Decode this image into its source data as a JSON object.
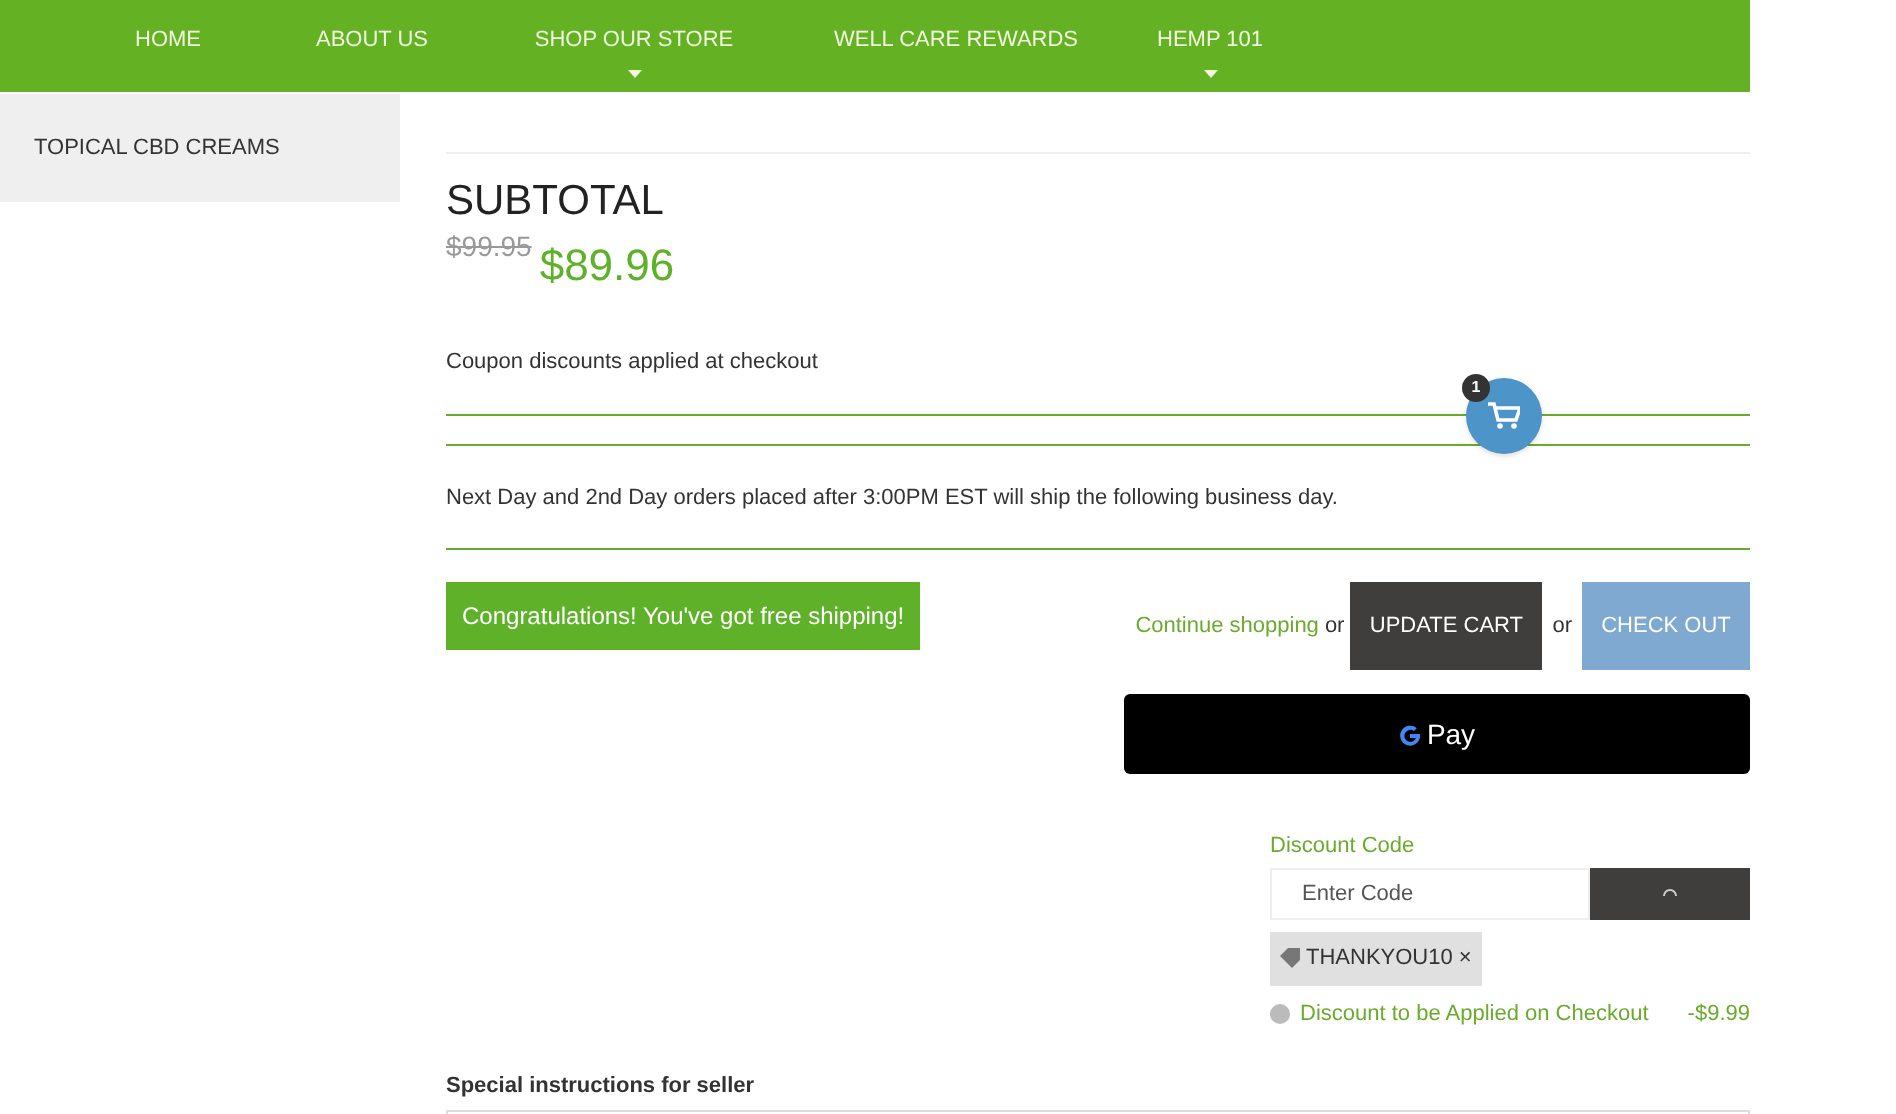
{
  "nav": [
    {
      "label": "HOME",
      "dropdown": false
    },
    {
      "label": "ABOUT US",
      "dropdown": false
    },
    {
      "label": "SHOP OUR STORE",
      "dropdown": true
    },
    {
      "label": "WELL CARE REWARDS",
      "dropdown": false
    },
    {
      "label": "HEMP 101",
      "dropdown": true
    }
  ],
  "sidebar": {
    "items": [
      "TOPICAL CBD CREAMS"
    ]
  },
  "subtotal": {
    "title": "SUBTOTAL",
    "original": "$99.95",
    "price": "$89.96"
  },
  "coupon_note": "Coupon discounts applied at checkout",
  "shipping_note": "Next Day and 2nd Day orders placed after 3:00PM EST will ship the following business day.",
  "free_shipping": "Congratulations! You've got free shipping!",
  "actions": {
    "continue": "Continue shopping",
    "or_1": "or",
    "update": "UPDATE CART",
    "or_2": "or",
    "checkout": "CHECK OUT",
    "gpay": "Pay"
  },
  "cart_badge": "1",
  "discount": {
    "label": "Discount Code",
    "placeholder": "Enter Code",
    "tag": "THANKYOU10",
    "remove": "×",
    "note": "Discount to be Applied on Checkout",
    "amount": "-$9.99"
  },
  "instructions": {
    "label": "Special instructions for seller"
  }
}
